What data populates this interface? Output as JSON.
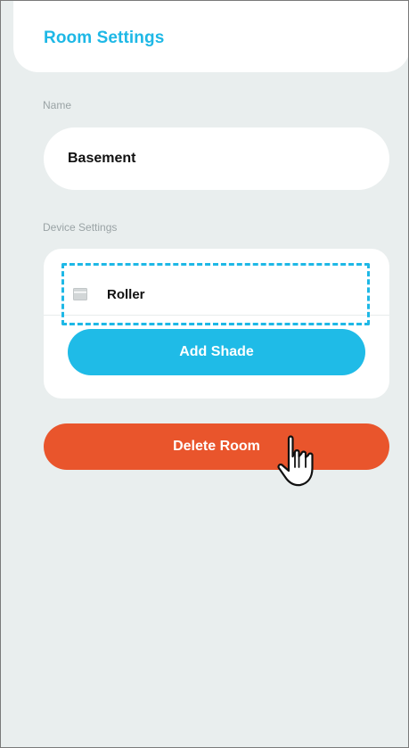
{
  "header": {
    "title": "Room Settings"
  },
  "name_section": {
    "label": "Name",
    "value": "Basement"
  },
  "device_section": {
    "label": "Device Settings",
    "shades": [
      {
        "label": "Roller",
        "icon": "roller-shade-icon"
      }
    ],
    "add_button_label": "Add Shade"
  },
  "actions": {
    "delete_room_label": "Delete Room"
  },
  "pointer": {
    "icon": "hand-pointer-icon"
  },
  "colors": {
    "accent": "#1eb8e6",
    "danger": "#e9552c",
    "background": "#e9eeee",
    "card": "#ffffff"
  }
}
